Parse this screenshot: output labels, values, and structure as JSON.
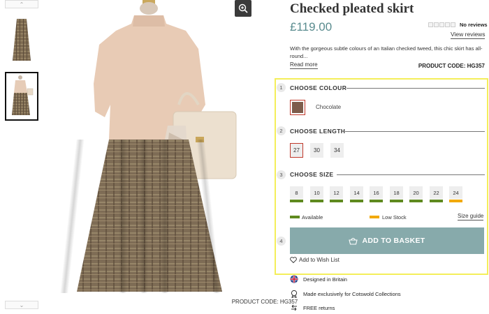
{
  "product": {
    "title": "Checked pleated skirt",
    "price": "£119.00",
    "reviews_text": "No reviews",
    "view_reviews": "View reviews",
    "description": "With the gorgeous subtle colours of an Italian checked tweed, this chic skirt has all-round...",
    "read_more": "Read more",
    "product_code": "PRODUCT CODE: HG357",
    "image_code": "PRODUCT CODE: HG357"
  },
  "steps": {
    "colour": {
      "num": "1",
      "title": "CHOOSE COLOUR",
      "selected_name": "Chocolate",
      "swatch_color": "#7e5d4c"
    },
    "length": {
      "num": "2",
      "title": "CHOOSE LENGTH",
      "options": [
        "27",
        "30",
        "34"
      ],
      "selected": "27"
    },
    "size": {
      "num": "3",
      "title": "CHOOSE SIZE",
      "options": [
        {
          "label": "8",
          "stock": "available"
        },
        {
          "label": "10",
          "stock": "available"
        },
        {
          "label": "12",
          "stock": "available"
        },
        {
          "label": "14",
          "stock": "available"
        },
        {
          "label": "16",
          "stock": "available"
        },
        {
          "label": "18",
          "stock": "available"
        },
        {
          "label": "20",
          "stock": "available"
        },
        {
          "label": "22",
          "stock": "available"
        },
        {
          "label": "24",
          "stock": "low"
        }
      ],
      "legend_available": "Available",
      "legend_low": "Low Stock",
      "size_guide": "Size guide"
    },
    "basket": {
      "num": "4",
      "label": "ADD TO BASKET"
    }
  },
  "wishlist": "Add to Wish List",
  "features": [
    {
      "icon": "union-flag-icon",
      "text": "Designed in Britain"
    },
    {
      "icon": "award-ribbon-icon",
      "text": "Made exclusively for Cotswold Collections"
    },
    {
      "icon": "return-arrow-icon",
      "text": "FREE returns"
    }
  ],
  "colors": {
    "accent": "#5a8c8f",
    "basket": "#87aaab",
    "available": "#5f8a1f",
    "low_stock": "#f2a900",
    "highlight": "#f4ee5a",
    "selected_border": "#c0392b"
  }
}
